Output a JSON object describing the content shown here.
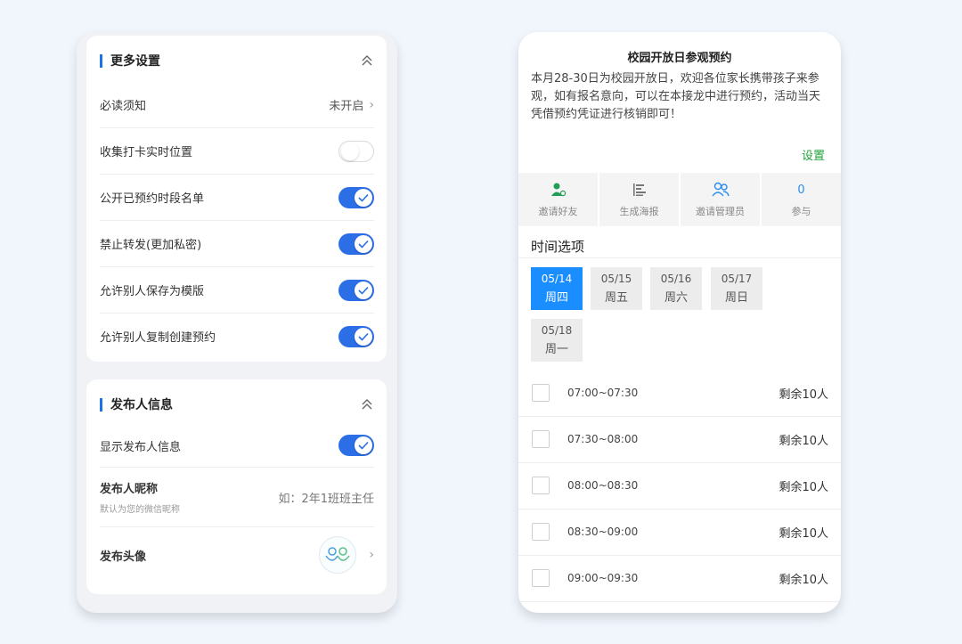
{
  "left": {
    "more_settings": {
      "title": "更多设置",
      "rows": [
        {
          "label": "必读须知",
          "value": "未开启"
        },
        {
          "label": "收集打卡实时位置",
          "toggle": "off"
        },
        {
          "label": "公开已预约时段名单",
          "toggle": "on"
        },
        {
          "label": "禁止转发(更加私密)",
          "toggle": "on"
        },
        {
          "label": "允许别人保存为模版",
          "toggle": "on"
        },
        {
          "label": "允许别人复制创建预约",
          "toggle": "on"
        }
      ]
    },
    "publisher_info": {
      "title": "发布人信息",
      "show_label": "显示发布人信息",
      "nickname_label": "发布人昵称",
      "nickname_sub": "默认为您的微信昵称",
      "nickname_placeholder": "如：2年1班班主任",
      "avatar_label": "发布头像"
    }
  },
  "right": {
    "title": "校园开放日参观预约",
    "description": "本月28-30日为校园开放日，欢迎各位家长携带孩子来参观，如有报名意向，可以在本接龙中进行预约，活动当天凭借预约凭证进行核销即可！",
    "settings_link": "设置",
    "actions": [
      {
        "icon": "invite-friend-icon",
        "label": "邀请好友"
      },
      {
        "icon": "poster-icon",
        "label": "生成海报"
      },
      {
        "icon": "invite-admin-icon",
        "label": "邀请管理员"
      },
      {
        "count": "0",
        "label": "参与"
      }
    ],
    "time_section_title": "时间选项",
    "dates": [
      {
        "date": "05/14",
        "weekday": "周四",
        "selected": true
      },
      {
        "date": "05/15",
        "weekday": "周五"
      },
      {
        "date": "05/16",
        "weekday": "周六"
      },
      {
        "date": "05/17",
        "weekday": "周日"
      },
      {
        "date": "05/18",
        "weekday": "周一"
      }
    ],
    "slots": [
      {
        "time": "07:00~07:30",
        "remaining": "剩余10人"
      },
      {
        "time": "07:30~08:00",
        "remaining": "剩余10人"
      },
      {
        "time": "08:00~08:30",
        "remaining": "剩余10人"
      },
      {
        "time": "08:30~09:00",
        "remaining": "剩余10人"
      },
      {
        "time": "09:00~09:30",
        "remaining": "剩余10人"
      }
    ]
  },
  "colors": {
    "accent_blue": "#2b6ee6",
    "selected_date": "#1a8dff",
    "settings_green": "#22a23a",
    "background": "#f1f6fd"
  }
}
